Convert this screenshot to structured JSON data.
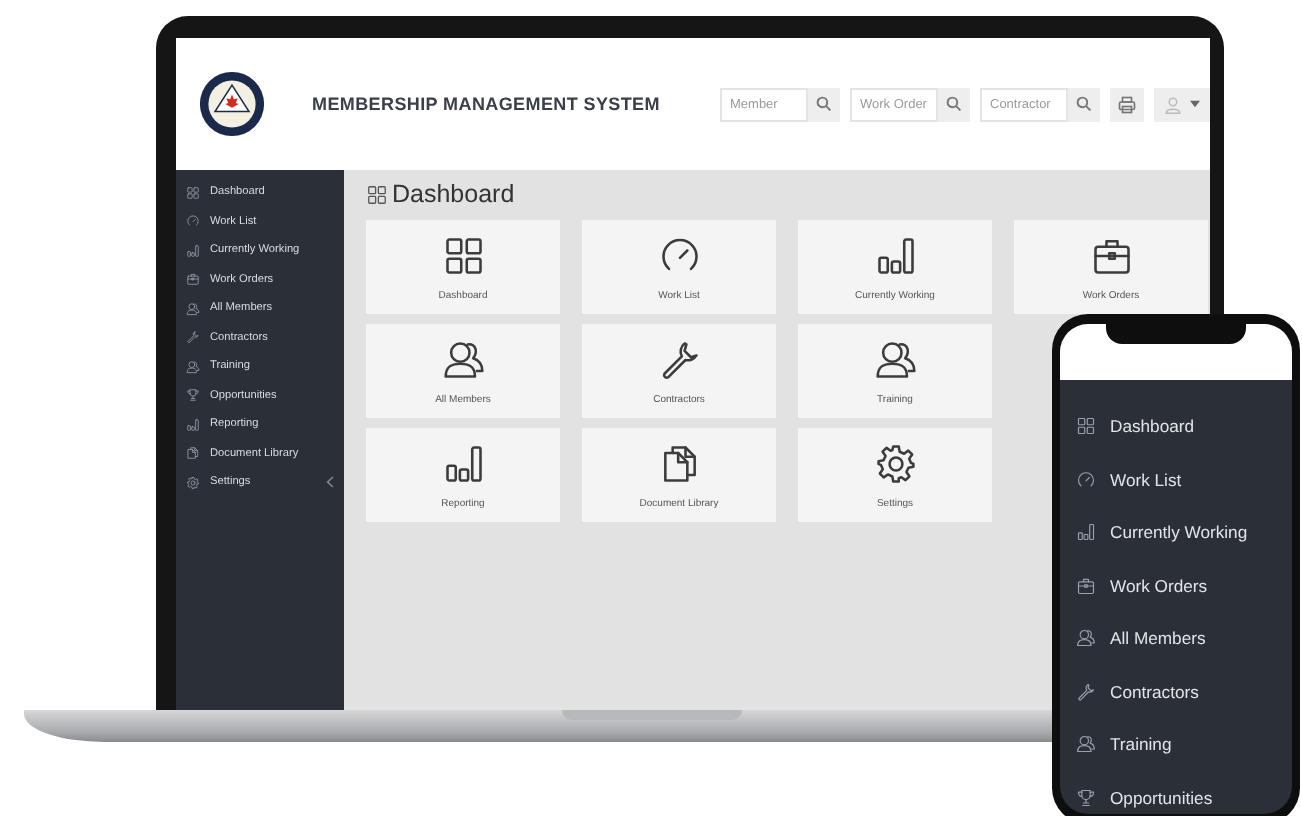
{
  "laptop": {
    "header": {
      "title": "MEMBERSHIP MANAGEMENT SYSTEM",
      "searches": [
        {
          "placeholder": "Member"
        },
        {
          "placeholder": "Work Order"
        },
        {
          "placeholder": "Contractor"
        }
      ]
    },
    "sidebar": {
      "items": [
        {
          "label": "Dashboard",
          "expandable": false
        },
        {
          "label": "Work List",
          "expandable": false
        },
        {
          "label": "Currently Working",
          "expandable": false
        },
        {
          "label": "Work Orders",
          "expandable": false
        },
        {
          "label": "All Members",
          "expandable": false
        },
        {
          "label": "Contractors",
          "expandable": false
        },
        {
          "label": "Training",
          "expandable": false
        },
        {
          "label": "Opportunities",
          "expandable": false
        },
        {
          "label": "Reporting",
          "expandable": false
        },
        {
          "label": "Document Library",
          "expandable": false
        },
        {
          "label": "Settings",
          "expandable": true
        }
      ]
    },
    "page_title": "Dashboard",
    "tiles": [
      {
        "label": "Dashboard"
      },
      {
        "label": "Work List"
      },
      {
        "label": "Currently Working"
      },
      {
        "label": "Work Orders"
      },
      {
        "label": "All Members"
      },
      {
        "label": "Contractors"
      },
      {
        "label": "Training"
      },
      {
        "label": "Reporting"
      },
      {
        "label": "Document Library"
      },
      {
        "label": "Settings"
      }
    ]
  },
  "phone": {
    "menu": [
      {
        "label": "Dashboard"
      },
      {
        "label": "Work List"
      },
      {
        "label": "Currently Working"
      },
      {
        "label": "Work Orders"
      },
      {
        "label": "All Members"
      },
      {
        "label": "Contractors"
      },
      {
        "label": "Training"
      },
      {
        "label": "Opportunities"
      }
    ]
  }
}
